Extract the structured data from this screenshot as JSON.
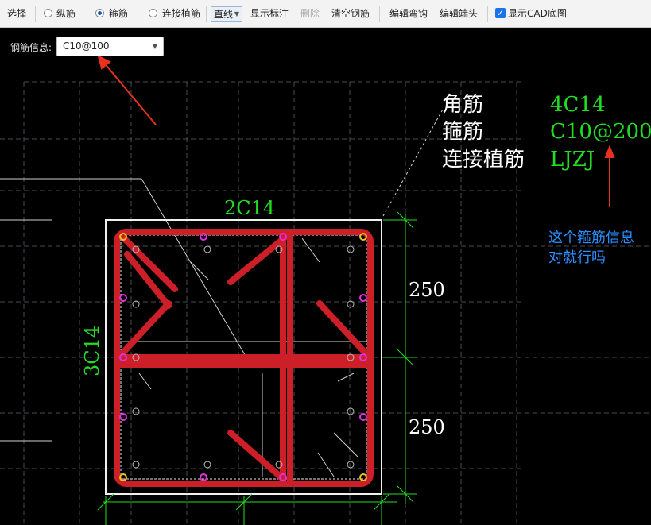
{
  "toolbar": {
    "select": "选择",
    "longitudinal": "纵筋",
    "stirrup": "箍筋",
    "anchor_bar": "连接植筋",
    "line_mode": "直线",
    "show_annotation": "显示标注",
    "delete": "删除",
    "clear_bars": "清空钢筋",
    "edit_hook": "编辑弯钩",
    "edit_end": "编辑端头",
    "show_cad": "显示CAD底图",
    "selected_mode": "stirrup",
    "show_cad_checked": true
  },
  "rebar_info": {
    "label": "钢筋信息:",
    "value": "C10@100"
  },
  "drawing": {
    "legend": [
      {
        "label": "角筋",
        "value": "4C14"
      },
      {
        "label": "箍筋",
        "value": "C10@200"
      },
      {
        "label": "连接植筋",
        "value": "LJZJ"
      }
    ],
    "top_bars": "2C14",
    "side_bars": "3C14",
    "dimensions": [
      "250",
      "250"
    ]
  },
  "annotation": {
    "text": "这个箍筋信息对就行吗",
    "color": "#2a8fff"
  },
  "colors": {
    "stirrup": "#cc1f28",
    "cad_text": "#22dd22",
    "dimension": "#22dd22",
    "grid": "#4a4a55"
  }
}
